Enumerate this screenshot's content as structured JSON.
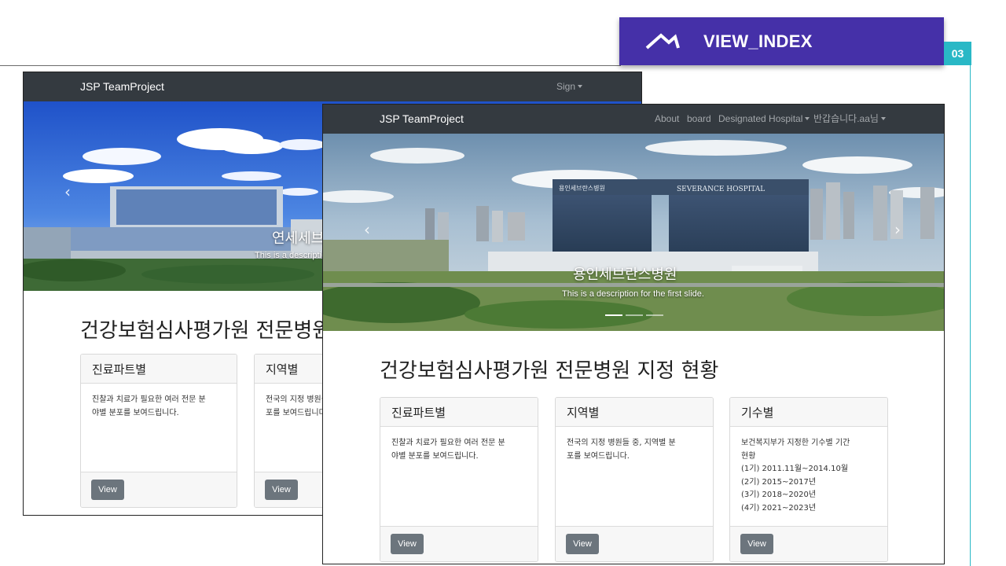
{
  "slide": {
    "title": "VIEW_INDEX",
    "page_number": "03"
  },
  "back_shot": {
    "brand": "JSP TeamProject",
    "nav": {
      "sign_label": "Sign"
    },
    "carousel": {
      "caption_title": "연세세브란스병원",
      "caption_desc": "This is a description for the first slide."
    },
    "heading": "건강보험심사평가원 전문병원 지정 현황",
    "cards": [
      {
        "title": "진료파트별",
        "body_lines": [
          "진찰과 치료가 필요한 여러 전문 분",
          "야별 분포를 보여드립니다."
        ],
        "button": "View"
      },
      {
        "title": "지역별",
        "body_lines": [
          "전국의 지정 병원들 중, 지역별 분",
          "포를 보여드립니다."
        ],
        "button": "View"
      }
    ]
  },
  "front_shot": {
    "brand": "JSP TeamProject",
    "nav": {
      "about": "About",
      "board": "board",
      "designated": "Designated Hospital",
      "user": "반갑습니다.aa님"
    },
    "carousel": {
      "caption_title": "용인세브란스병원",
      "caption_desc": "This is a description for the first slide.",
      "building_sign": "SEVERANCE HOSPITAL",
      "building_sign_kr": "용인세브란스병원"
    },
    "heading": "건강보험심사평가원 전문병원 지정 현황",
    "cards": [
      {
        "title": "진료파트별",
        "body_lines": [
          "진찰과 치료가 필요한 여러 전문 분",
          "야별 분포를 보여드립니다."
        ],
        "button": "View"
      },
      {
        "title": "지역별",
        "body_lines": [
          "전국의 지정 병원들 중, 지역별 분",
          "포를 보여드립니다."
        ],
        "button": "View"
      },
      {
        "title": "기수별",
        "body_lines": [
          "보건복지부가 지정한 기수별 기간",
          "현황",
          "(1기) 2011.11월~2014.10월",
          "(2기) 2015~2017년",
          "(3기) 2018~2020년",
          "(4기) 2021~2023년"
        ],
        "button": "View"
      }
    ]
  },
  "colors": {
    "accent": "#4530a8",
    "teal": "#29b8c6",
    "navbar": "#343a40",
    "button": "#6c757d"
  },
  "icons": {
    "slide_title_icon": "chevron-up-roof-icon",
    "prev": "chevron-left-icon",
    "next": "chevron-right-icon"
  }
}
